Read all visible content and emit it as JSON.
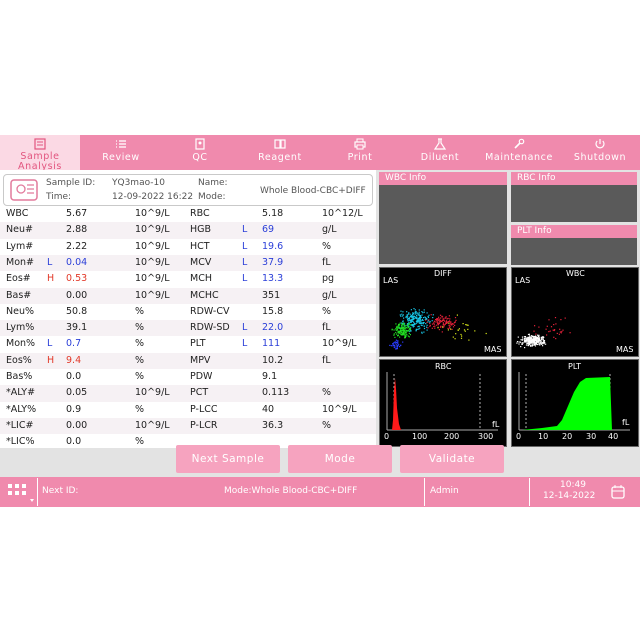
{
  "toolbar": {
    "items": [
      {
        "icon": "sample-analysis-icon",
        "label_line1": "Sample",
        "label_line2": "Analysis"
      },
      {
        "icon": "review-icon",
        "label": "Review"
      },
      {
        "icon": "qc-icon",
        "label": "QC"
      },
      {
        "icon": "reagent-icon",
        "label": "Reagent"
      },
      {
        "icon": "print-icon",
        "label": "Print"
      },
      {
        "icon": "diluent-icon",
        "label": "Diluent"
      },
      {
        "icon": "maintenance-icon",
        "label": "Maintenance"
      },
      {
        "icon": "shutdown-icon",
        "label": "Shutdown"
      }
    ],
    "accent": "#f08aad",
    "active_bg": "#fbd9e4"
  },
  "sample": {
    "id_label": "Sample ID:",
    "id_value": "YQ3mao-10",
    "name_label": "Name:",
    "name_value": "",
    "time_label": "Time:",
    "time_value": "12-09-2022 16:22",
    "mode_label": "Mode:",
    "mode_value": "Whole Blood-CBC+DIFF"
  },
  "results": [
    {
      "n1": "WBC",
      "f1": "",
      "v1": "5.67",
      "u1": "10^9/L",
      "n2": "RBC",
      "f2": "",
      "v2": "5.18",
      "u2": "10^12/L"
    },
    {
      "n1": "Neu#",
      "f1": "",
      "v1": "2.88",
      "u1": "10^9/L",
      "n2": "HGB",
      "f2": "L",
      "v2": "69",
      "u2": "g/L"
    },
    {
      "n1": "Lym#",
      "f1": "",
      "v1": "2.22",
      "u1": "10^9/L",
      "n2": "HCT",
      "f2": "L",
      "v2": "19.6",
      "u2": "%"
    },
    {
      "n1": "Mon#",
      "f1": "L",
      "v1": "0.04",
      "u1": "10^9/L",
      "n2": "MCV",
      "f2": "L",
      "v2": "37.9",
      "u2": "fL"
    },
    {
      "n1": "Eos#",
      "f1": "H",
      "v1": "0.53",
      "u1": "10^9/L",
      "n2": "MCH",
      "f2": "L",
      "v2": "13.3",
      "u2": "pg"
    },
    {
      "n1": "Bas#",
      "f1": "",
      "v1": "0.00",
      "u1": "10^9/L",
      "n2": "MCHC",
      "f2": "",
      "v2": "351",
      "u2": "g/L"
    },
    {
      "n1": "Neu%",
      "f1": "",
      "v1": "50.8",
      "u1": "%",
      "n2": "RDW-CV",
      "f2": "",
      "v2": "15.8",
      "u2": "%"
    },
    {
      "n1": "Lym%",
      "f1": "",
      "v1": "39.1",
      "u1": "%",
      "n2": "RDW-SD",
      "f2": "L",
      "v2": "22.0",
      "u2": "fL"
    },
    {
      "n1": "Mon%",
      "f1": "L",
      "v1": "0.7",
      "u1": "%",
      "n2": "PLT",
      "f2": "L",
      "v2": "111",
      "u2": "10^9/L"
    },
    {
      "n1": "Eos%",
      "f1": "H",
      "v1": "9.4",
      "u1": "%",
      "n2": "MPV",
      "f2": "",
      "v2": "10.2",
      "u2": "fL"
    },
    {
      "n1": "Bas%",
      "f1": "",
      "v1": "0.0",
      "u1": "%",
      "n2": "PDW",
      "f2": "",
      "v2": "9.1",
      "u2": ""
    },
    {
      "n1": "*ALY#",
      "f1": "",
      "v1": "0.05",
      "u1": "10^9/L",
      "n2": "PCT",
      "f2": "",
      "v2": "0.113",
      "u2": "%"
    },
    {
      "n1": "*ALY%",
      "f1": "",
      "v1": "0.9",
      "u1": "%",
      "n2": "P-LCC",
      "f2": "",
      "v2": "40",
      "u2": "10^9/L"
    },
    {
      "n1": "*LIC#",
      "f1": "",
      "v1": "0.00",
      "u1": "10^9/L",
      "n2": "P-LCR",
      "f2": "",
      "v2": "36.3",
      "u2": "%"
    },
    {
      "n1": "*LIC%",
      "f1": "",
      "v1": "0.0",
      "u1": "%",
      "n2": "",
      "f2": "",
      "v2": "",
      "u2": ""
    }
  ],
  "info_panels": {
    "wbc": "WBC Info",
    "rbc": "RBC Info",
    "plt": "PLT Info"
  },
  "plots": {
    "diff": {
      "title": "DIFF",
      "y": "LAS",
      "x": "MAS"
    },
    "wbc": {
      "title": "WBC",
      "y": "LAS",
      "x": "MAS"
    },
    "rbc": {
      "title": "RBC",
      "x_unit": "fL",
      "ticks": [
        "0",
        "100",
        "200",
        "300"
      ]
    },
    "plt": {
      "title": "PLT",
      "x_unit": "fL",
      "ticks": [
        "0",
        "10",
        "20",
        "30",
        "40"
      ]
    }
  },
  "actions": {
    "next_sample": "Next Sample",
    "mode": "Mode",
    "validate": "Validate"
  },
  "status": {
    "next_id_label": "Next ID:",
    "mode_text": "Mode:Whole Blood-CBC+DIFF",
    "user": "Admin",
    "time": "10:49",
    "date": "12-14-2022"
  },
  "colors": {
    "low": "#2b3fd8",
    "high": "#e23a2a",
    "plt_fill": "#00ff00",
    "rbc_fill": "#ff1a1a"
  }
}
